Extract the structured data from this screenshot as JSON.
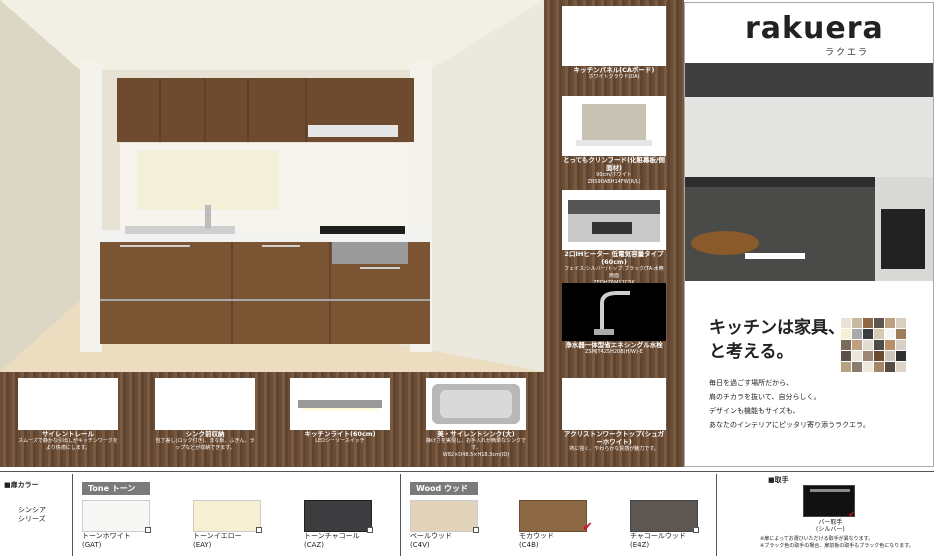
{
  "brand": {
    "logo": "rakuera",
    "logo_kana": "ラクエラ",
    "tagline1": "キッチンは家具、",
    "tagline2": "と考える。",
    "body": [
      "毎日を過ごす場所だから、",
      "肩のチカラを抜いて、自分らしく。",
      "デザインも機能もサイズも、",
      "あなたのインテリアにピッタリ寄り添うラクエラ。"
    ]
  },
  "right_panels": [
    {
      "title": "キッチンパネル(CAボード)",
      "sub": "ホワイトクラウド(DA)"
    },
    {
      "title": "とってもクリンフード(化粧幕板/側面材)",
      "sub": "90cm/ホワイト\nZRS90ABH14FW(R/L)"
    },
    {
      "title": "2口IHヒーター 低電気容量タイプ(60cm)",
      "sub": "フェイス:シルバー/トップ:ブラック(TA-水無両面\nZEDHZ6M17CSK"
    },
    {
      "title": "浄水器一体型省エネシングル水栓",
      "sub": "ZSMJT425H20B(H/W)-E"
    }
  ],
  "bottom_panels": [
    {
      "title": "サイレントレール",
      "sub": "スムーズで静かな引出しがキッチンワークをより快適にします。"
    },
    {
      "title": "シンク前収納",
      "sub": "包丁差し(ロック付き)、まな板、ふきん、ラップなどが収納できます。"
    },
    {
      "title": "キッチンライト(60cm)",
      "sub": "LEDシーソースイッチ"
    },
    {
      "title": "美・サイレントシンク(大)",
      "sub": "静けさを実現し、お手入れが簡単なシンクです。\nW82×D48.5×H18.3cm(ID)"
    },
    {
      "title": "アクリストンワークトップ(シュガーホワイト)",
      "sub": "熱に強く、やわらかな質感が魅力です。"
    }
  ],
  "colors": {
    "section_label": "■扉カラー",
    "series_label": "シンシア\nシリーズ",
    "tone_head": "Tone トーン",
    "wood_head": "Wood ウッド",
    "swatches": [
      {
        "name": "トーンホワイト",
        "code": "(GAT)",
        "color": "#f7f7f5"
      },
      {
        "name": "トーンイエロー",
        "code": "(EAY)",
        "color": "#f6efd2"
      },
      {
        "name": "トーンチャコール",
        "code": "(CAZ)",
        "color": "#3d3d3f"
      },
      {
        "name": "ペールウッド",
        "code": "(C4V)",
        "color": "#e2d3bb"
      },
      {
        "name": "モカウッド",
        "code": "(C4B)",
        "color": "#8d6845"
      },
      {
        "name": "チャコールウッド",
        "code": "(E4Z)",
        "color": "#5e5650"
      }
    ],
    "handle_head": "■取手",
    "handle_name": "バー取手\n(シルバー)",
    "handle_note1": "※扉によってお選びいただける取手が異なります。",
    "handle_note2": "※ブラック色の取手の場合、扉前板の取手もブラック色になります。"
  }
}
